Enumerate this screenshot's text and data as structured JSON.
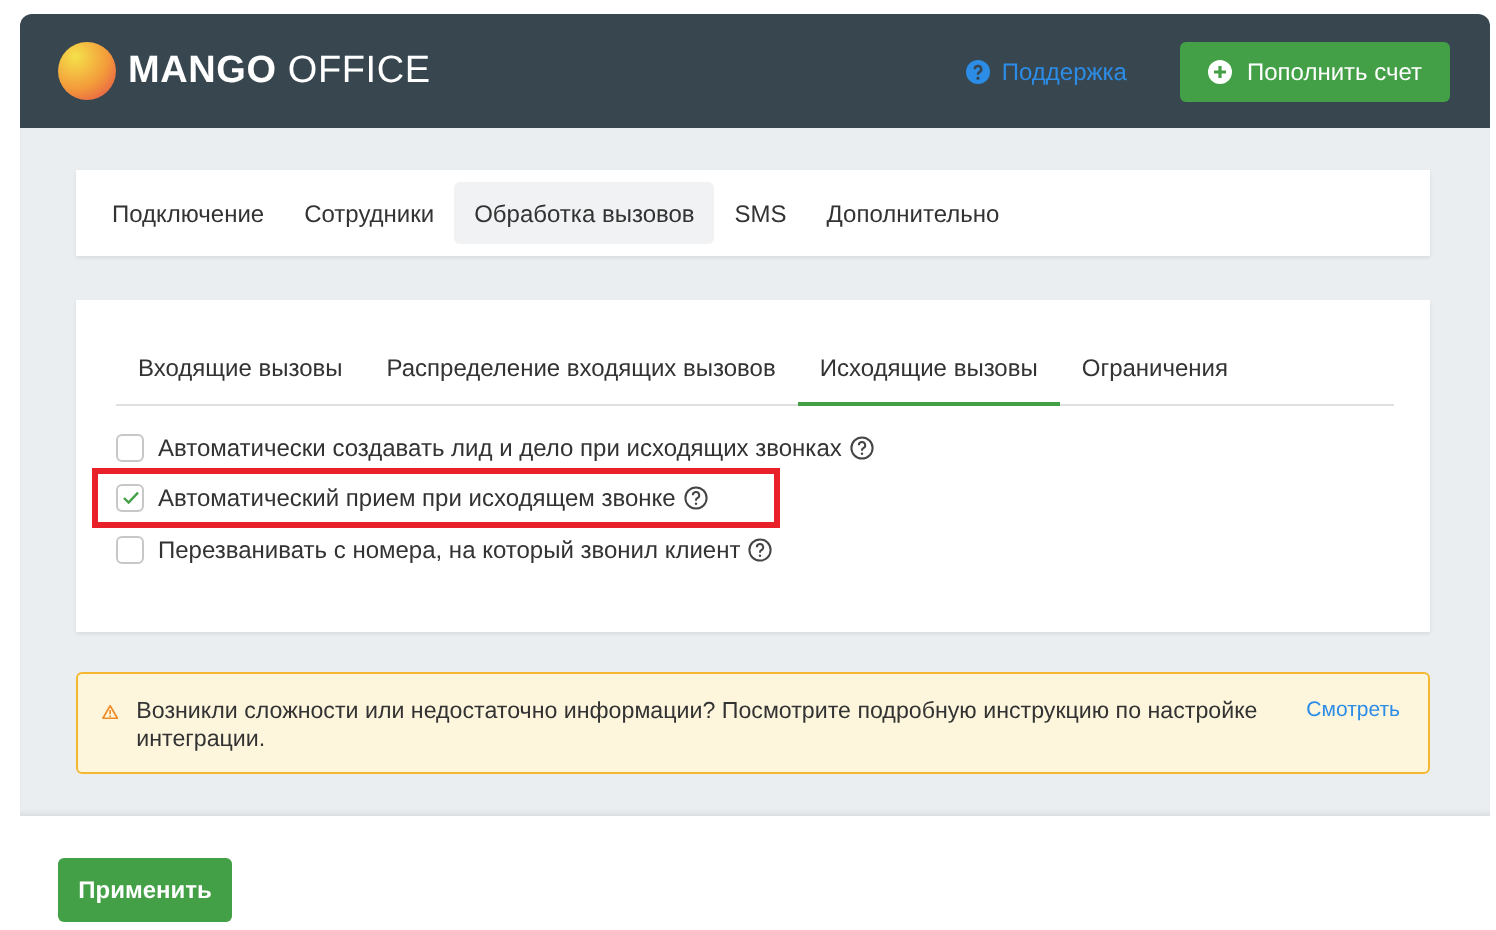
{
  "header": {
    "logo": "**MANGO** OFFICE",
    "support_link": "Поддержка",
    "topup_button": "Пополнить счет"
  },
  "main_tabs": [
    {
      "label": "Подключение",
      "selected": false
    },
    {
      "label": "Сотрудники",
      "selected": false
    },
    {
      "label": "Обработка вызовов",
      "selected": true
    },
    {
      "label": "SMS",
      "selected": false
    },
    {
      "label": "Дополнительно",
      "selected": false
    }
  ],
  "sub_tabs": [
    {
      "label": "Входящие вызовы",
      "selected": false
    },
    {
      "label": "Распределение входящих вызовов",
      "selected": false
    },
    {
      "label": "Исходящие вызовы",
      "selected": true
    },
    {
      "label": "Ограничения",
      "selected": false
    }
  ],
  "options": [
    {
      "label": "Автоматически создавать лид и дело при исходящих звонках",
      "checked": false,
      "highlighted": false
    },
    {
      "label": "Автоматический прием при исходящем звонке",
      "checked": true,
      "highlighted": true
    },
    {
      "label": "Перезванивать с номера, на который звонил клиент",
      "checked": false,
      "highlighted": false
    }
  ],
  "alert": {
    "text": "Возникли сложности или недостаточно информации? Посмотрите подробную инструкцию по настройке интеграции.",
    "link": "Смотреть"
  },
  "apply_button": "Применить"
}
